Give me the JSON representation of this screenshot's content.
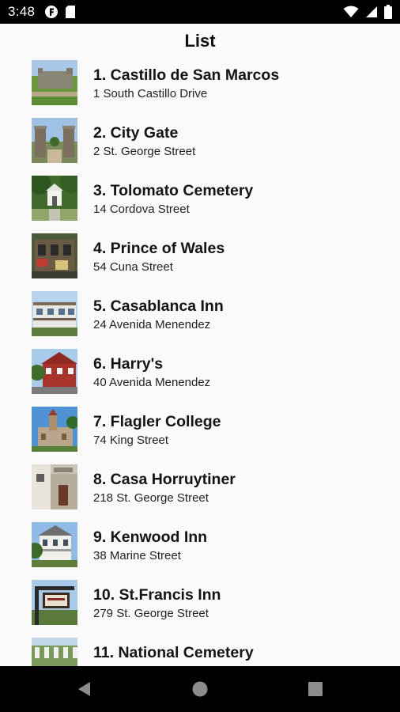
{
  "status_bar": {
    "time": "3:48",
    "left_icons": [
      "app-f-icon",
      "sd-card-icon"
    ],
    "right_icons": [
      "wifi-icon",
      "signal-icon",
      "battery-icon"
    ]
  },
  "header": {
    "title": "List"
  },
  "items": [
    {
      "name": "1. Castillo de San Marcos",
      "address": "1 South Castillo Drive",
      "thumb": "fort-photo"
    },
    {
      "name": "2. City Gate",
      "address": "2 St. George Street",
      "thumb": "gate-photo"
    },
    {
      "name": "3. Tolomato Cemetery",
      "address": "14 Cordova Street",
      "thumb": "cemetery-chapel-photo"
    },
    {
      "name": "4. Prince of Wales",
      "address": "54 Cuna Street",
      "thumb": "pub-photo"
    },
    {
      "name": "5. Casablanca Inn",
      "address": "24 Avenida Menendez",
      "thumb": "inn-photo"
    },
    {
      "name": "6. Harry's",
      "address": "40 Avenida Menendez",
      "thumb": "red-house-photo"
    },
    {
      "name": "7. Flagler College",
      "address": "74 King Street",
      "thumb": "college-photo"
    },
    {
      "name": "8. Casa Horruytiner",
      "address": "218 St. George Street",
      "thumb": "house-photo"
    },
    {
      "name": "9. Kenwood Inn",
      "address": "38 Marine Street",
      "thumb": "white-inn-photo"
    },
    {
      "name": "10. St.Francis Inn",
      "address": "279 St. George Street",
      "thumb": "sign-photo"
    },
    {
      "name": "11. National Cemetery",
      "address": "",
      "thumb": "graves-photo"
    }
  ],
  "nav_bar": {
    "buttons": [
      "back-icon",
      "home-icon",
      "recents-icon"
    ]
  }
}
